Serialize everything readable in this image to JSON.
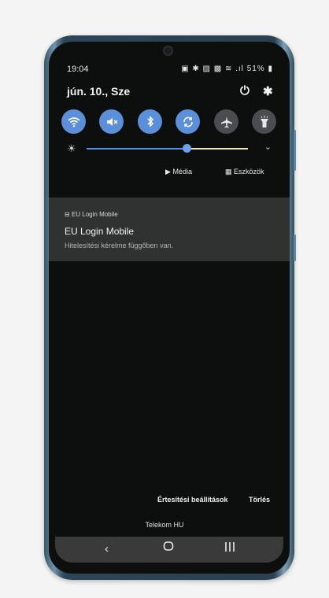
{
  "status_bar": {
    "time": "19:04",
    "icons_text": "▣ ✱ ▨ ▩ ≋ .ıl",
    "battery": "51%",
    "icon_names": [
      "nfc-icon",
      "bluetooth-icon",
      "mute-icon",
      "wifi-icon",
      "signal-icon",
      "battery-icon"
    ]
  },
  "header": {
    "date": "jún. 10., Sze",
    "power_icon": "⏻",
    "settings_icon": "✱"
  },
  "quick_settings": [
    {
      "name": "wifi",
      "glyph": "◉",
      "state": "on"
    },
    {
      "name": "sound-mute",
      "glyph": "✕",
      "state": "on"
    },
    {
      "name": "bluetooth",
      "glyph": "✱",
      "state": "on"
    },
    {
      "name": "auto-rotate",
      "glyph": "⟳",
      "state": "on"
    },
    {
      "name": "airplane-mode",
      "glyph": "✈",
      "state": "off"
    },
    {
      "name": "flashlight",
      "glyph": "▼",
      "state": "off"
    }
  ],
  "brightness": {
    "level": 0.62
  },
  "media_row": {
    "media_label": "Média",
    "devices_label": "Eszközök"
  },
  "notification": {
    "app_name": "EU Login Mobile",
    "title": "EU Login Mobile",
    "body": "Hitelesítési kérelme függőben van."
  },
  "actions": {
    "settings_label": "Értesítési beállítások",
    "clear_label": "Törlés"
  },
  "carrier": "Telekom HU",
  "colors": {
    "accent": "#5b8fd9",
    "card": "#2f3231",
    "background": "#0d0e0e"
  }
}
